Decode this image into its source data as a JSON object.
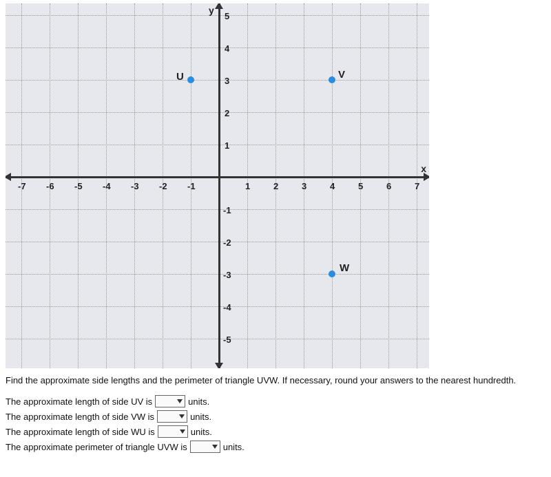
{
  "chart_data": {
    "type": "scatter",
    "title": "",
    "xlabel": "x",
    "ylabel": "y",
    "xlim": [
      -7.5,
      7.5
    ],
    "ylim": [
      -5.5,
      5.5
    ],
    "xticks": [
      -7,
      -6,
      -5,
      -4,
      -3,
      -2,
      -1,
      1,
      2,
      3,
      4,
      5,
      6,
      7
    ],
    "yticks": [
      -5,
      -4,
      -3,
      -2,
      -1,
      1,
      2,
      3,
      4,
      5
    ],
    "series": [
      {
        "name": "U",
        "x": -1,
        "y": 3
      },
      {
        "name": "V",
        "x": 4,
        "y": 3
      },
      {
        "name": "W",
        "x": 4,
        "y": -3
      }
    ]
  },
  "instruction": "Find the approximate side lengths and the perimeter of triangle UVW. If necessary, round your answers to the nearest hundredth.",
  "answers": {
    "uv_prefix": "The approximate length of side UV is",
    "vw_prefix": "The approximate length of side VW is",
    "wu_prefix": "The approximate length of side WU is",
    "perim_prefix": "The approximate perimeter of triangle UVW is",
    "units": "units."
  },
  "points": {
    "U": {
      "label": "U"
    },
    "V": {
      "label": "V"
    },
    "W": {
      "label": "W"
    }
  },
  "axis_labels": {
    "x": "x",
    "y": "y"
  },
  "tick_text": {
    "n7": "-7",
    "n6": "-6",
    "n5": "-5",
    "n4": "-4",
    "n3": "-3",
    "n2": "-2",
    "n1": "-1",
    "p1": "1",
    "p2": "2",
    "p3": "3",
    "p4": "4",
    "p5": "5",
    "p6": "6",
    "p7": "7"
  },
  "ytick_text": {
    "n5": "-5",
    "n4": "-4",
    "n3": "-3",
    "n2": "-2",
    "n1": "-1",
    "p1": "1",
    "p2": "2",
    "p3": "3",
    "p4": "4",
    "p5": "5"
  }
}
